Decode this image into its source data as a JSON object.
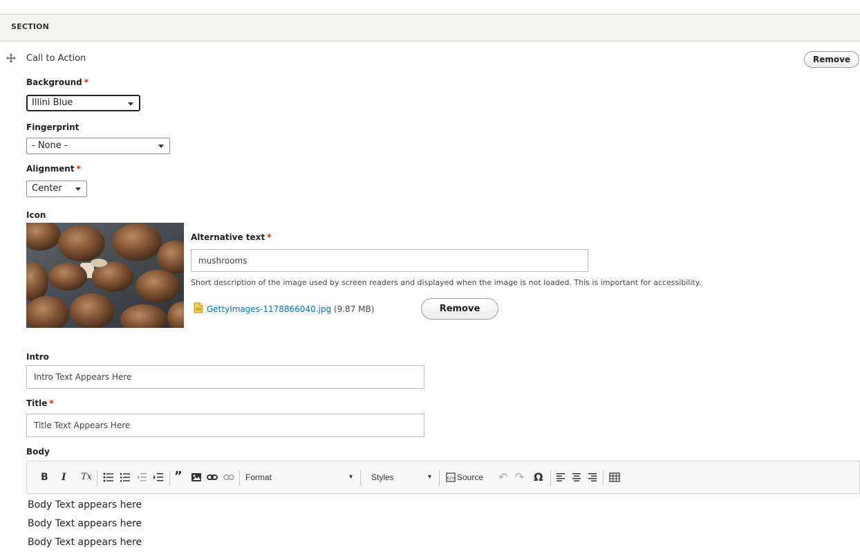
{
  "section_header": "SECTION",
  "paragraph": {
    "title": "Call to Action",
    "remove_label": "Remove"
  },
  "background": {
    "label": "Background",
    "value": "Illini Blue"
  },
  "fingerprint": {
    "label": "Fingerprint",
    "value": "- None -"
  },
  "alignment": {
    "label": "Alignment",
    "value": "Center"
  },
  "icon": {
    "label": "Icon",
    "alt_label": "Alternative text",
    "alt_value": "mushrooms",
    "alt_description": "Short description of the image used by screen readers and displayed when the image is not loaded. This is important for accessibility.",
    "file_name": "GettyImages-1178866040.jpg",
    "file_size": "(9.87 MB)",
    "remove_label": "Remove"
  },
  "intro": {
    "label": "Intro",
    "value": "Intro Text Appears Here"
  },
  "title_field": {
    "label": "Title",
    "value": "Title Text Appears Here"
  },
  "body": {
    "label": "Body",
    "toolbar": {
      "bold": "B",
      "italic": "I",
      "remove_format": "Tx",
      "format_label": "Format",
      "styles_label": "Styles",
      "source_label": "Source",
      "special_char": "Ω"
    },
    "lines": [
      "Body Text appears here",
      "Body Text appears here",
      "Body Text appears here"
    ]
  },
  "colors": {
    "required": "#e32700",
    "link": "#0071b8"
  }
}
